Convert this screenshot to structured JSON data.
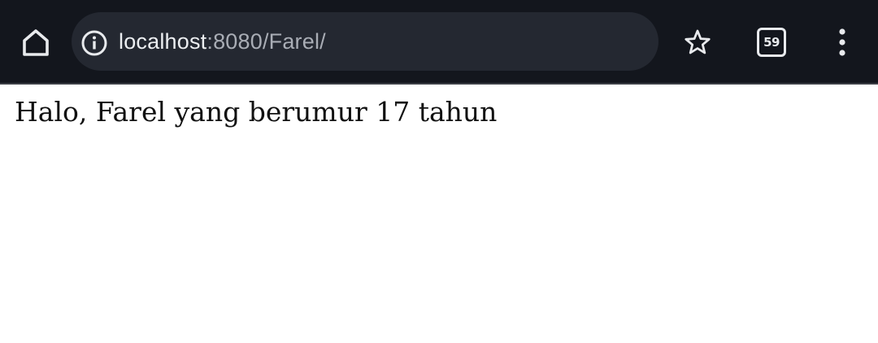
{
  "browser": {
    "url_host": "localhost",
    "url_rest": ":8080/Farel/",
    "tab_count": "59",
    "icons": {
      "home": "home-icon",
      "info": "info-icon",
      "bookmark": "star-icon",
      "tabs": "tab-switcher-icon",
      "menu": "kebab-menu-icon"
    },
    "colors": {
      "toolbar_bg": "#13161d",
      "omnibox_bg": "#242831",
      "icon": "#e8eaed"
    }
  },
  "page": {
    "body_text": "Halo, Farel yang berumur 17 tahun"
  }
}
